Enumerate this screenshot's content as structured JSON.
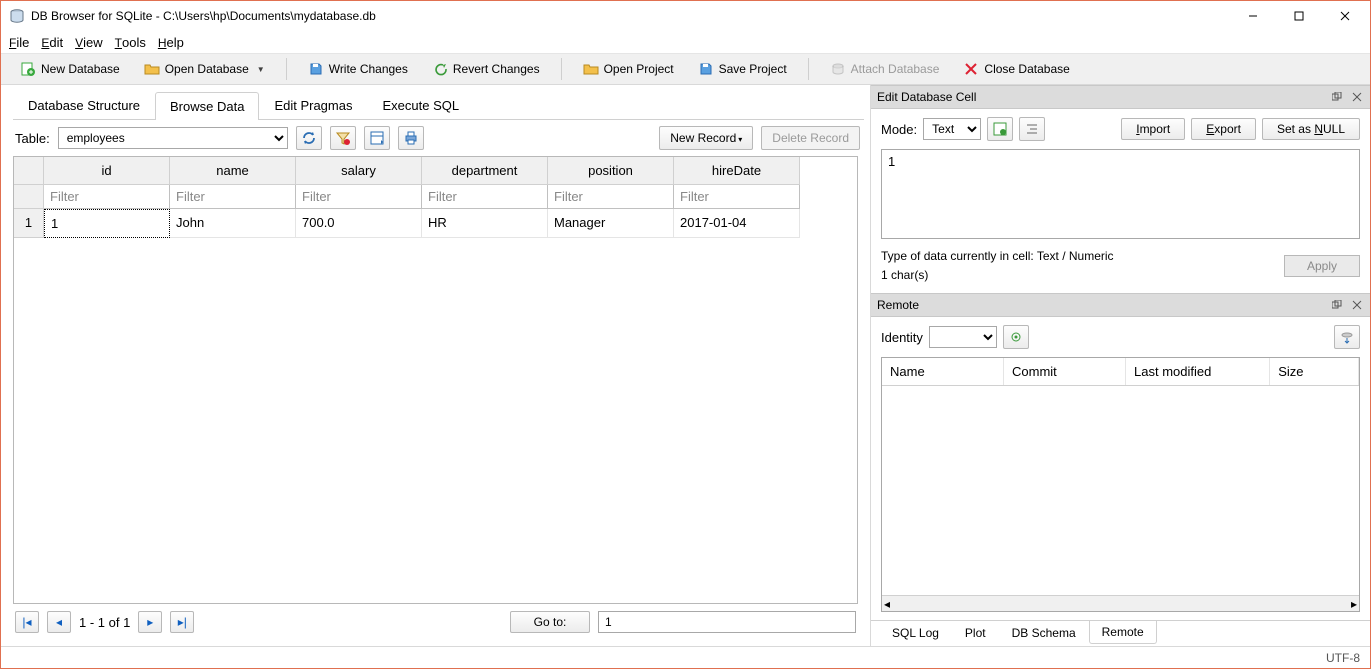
{
  "titlebar": {
    "title": "DB Browser for SQLite - C:\\Users\\hp\\Documents\\mydatabase.db"
  },
  "menubar": {
    "file": "File",
    "edit": "Edit",
    "view": "View",
    "tools": "Tools",
    "help": "Help"
  },
  "toolbar": {
    "new_db": "New Database",
    "open_db": "Open Database",
    "write_changes": "Write Changes",
    "revert_changes": "Revert Changes",
    "open_project": "Open Project",
    "save_project": "Save Project",
    "attach_db": "Attach Database",
    "close_db": "Close Database"
  },
  "tabs": {
    "structure": "Database Structure",
    "browse": "Browse Data",
    "pragmas": "Edit Pragmas",
    "sql": "Execute SQL"
  },
  "browse": {
    "table_label": "Table:",
    "selected_table": "employees",
    "new_record": "New Record",
    "delete_record": "Delete Record",
    "columns": [
      "id",
      "name",
      "salary",
      "department",
      "position",
      "hireDate"
    ],
    "filter_ph": "Filter",
    "rows": [
      {
        "num": "1",
        "cells": [
          "1",
          "John",
          "700.0",
          "HR",
          "Manager",
          "2017-01-04"
        ]
      }
    ],
    "nav_status": "1 - 1 of 1",
    "goto_label": "Go to:",
    "goto_value": "1"
  },
  "edit_cell": {
    "panel_title": "Edit Database Cell",
    "mode_label": "Mode:",
    "mode_value": "Text",
    "import": "Import",
    "export": "Export",
    "set_null": "Set as NULL",
    "cell_value": "1",
    "type_info": "Type of data currently in cell: Text / Numeric",
    "chars_info": "1 char(s)",
    "apply": "Apply"
  },
  "remote": {
    "panel_title": "Remote",
    "identity_label": "Identity",
    "columns": [
      "Name",
      "Commit",
      "Last modified",
      "Size"
    ]
  },
  "bottom_tabs": {
    "sql_log": "SQL Log",
    "plot": "Plot",
    "db_schema": "DB Schema",
    "remote": "Remote"
  },
  "status": {
    "encoding": "UTF-8"
  }
}
